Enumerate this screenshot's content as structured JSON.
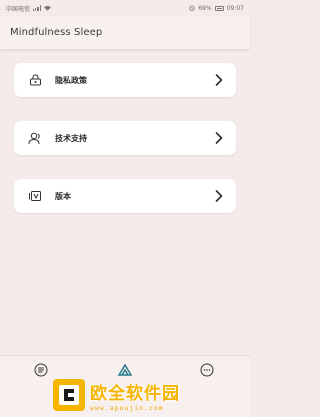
{
  "status_bar": {
    "carrier": "中国电信",
    "battery_pct": "69%",
    "time": "09:07"
  },
  "app_bar": {
    "title": "Mindfulness Sleep"
  },
  "menu": [
    {
      "label": "隐私政策",
      "icon": "lock-icon"
    },
    {
      "label": "技术支持",
      "icon": "support-person-icon"
    },
    {
      "label": "版本",
      "icon": "version-icon"
    }
  ],
  "bottom_nav": {
    "tabs": [
      "home-icon",
      "moon-icon",
      "more-icon"
    ]
  },
  "watermark": {
    "title": "欧全软件园",
    "url": "www.apoujin.com",
    "color": "#f5b400"
  }
}
